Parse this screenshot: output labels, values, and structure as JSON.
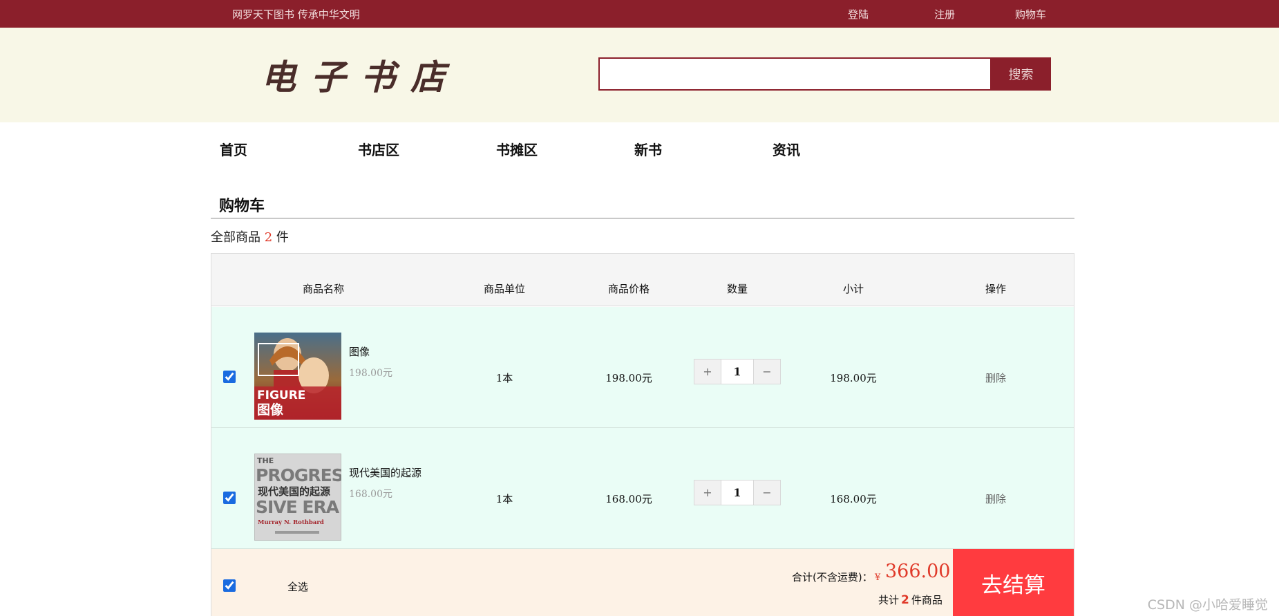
{
  "topbar": {
    "slogan": "网罗天下图书  传承中华文明",
    "links": {
      "login": "登陆",
      "register": "注册",
      "cart": "购物车"
    }
  },
  "header": {
    "logo": "电子书店",
    "search_placeholder": "",
    "search_button": "搜索"
  },
  "nav": [
    "首页",
    "书店区",
    "书摊区",
    "新书",
    "资讯"
  ],
  "cart": {
    "title": "购物车",
    "count_prefix": "全部商品",
    "count": "2",
    "count_suffix": "件",
    "columns": [
      "商品名称",
      "商品单位",
      "商品价格",
      "数量",
      "小计",
      "操作"
    ],
    "items": [
      {
        "checked": true,
        "name": "图像",
        "sub_price": "198.00元",
        "unit": "1本",
        "price": "198.00元",
        "qty_plus": "+",
        "qty": "1",
        "qty_minus": "−",
        "subtotal": "198.00元",
        "action": "删除",
        "cover_text": {
          "title_en": "FIGURE",
          "title_cn": "图像"
        }
      },
      {
        "checked": true,
        "name": "现代美国的起源",
        "sub_price": "168.00元",
        "unit": "1本",
        "price": "168.00元",
        "qty_plus": "+",
        "qty": "1",
        "qty_minus": "−",
        "subtotal": "168.00元",
        "action": "删除",
        "cover_text": {
          "line1": "THE",
          "line2": "PROGRES",
          "title_cn": "现代美国的起源",
          "line3": "SIVE ERA",
          "author": "Murray N. Rothbard"
        }
      }
    ],
    "footer": {
      "select_all": "全选",
      "total_label": "合计(不含运费)：",
      "currency": "¥",
      "total": "366.00",
      "count_prefix": "共计",
      "count": "2",
      "count_suffix": "件商品",
      "checkout": "去结算"
    }
  },
  "watermark": "CSDN @小哈爱睡觉",
  "colors": {
    "brand": "#8b1f2b",
    "accent": "#e03a2a",
    "checkout": "#ff3b3f",
    "row_bg": "#eafdf6",
    "footer_bg": "#fdf2e6",
    "header_bg": "#f8f7e7"
  }
}
